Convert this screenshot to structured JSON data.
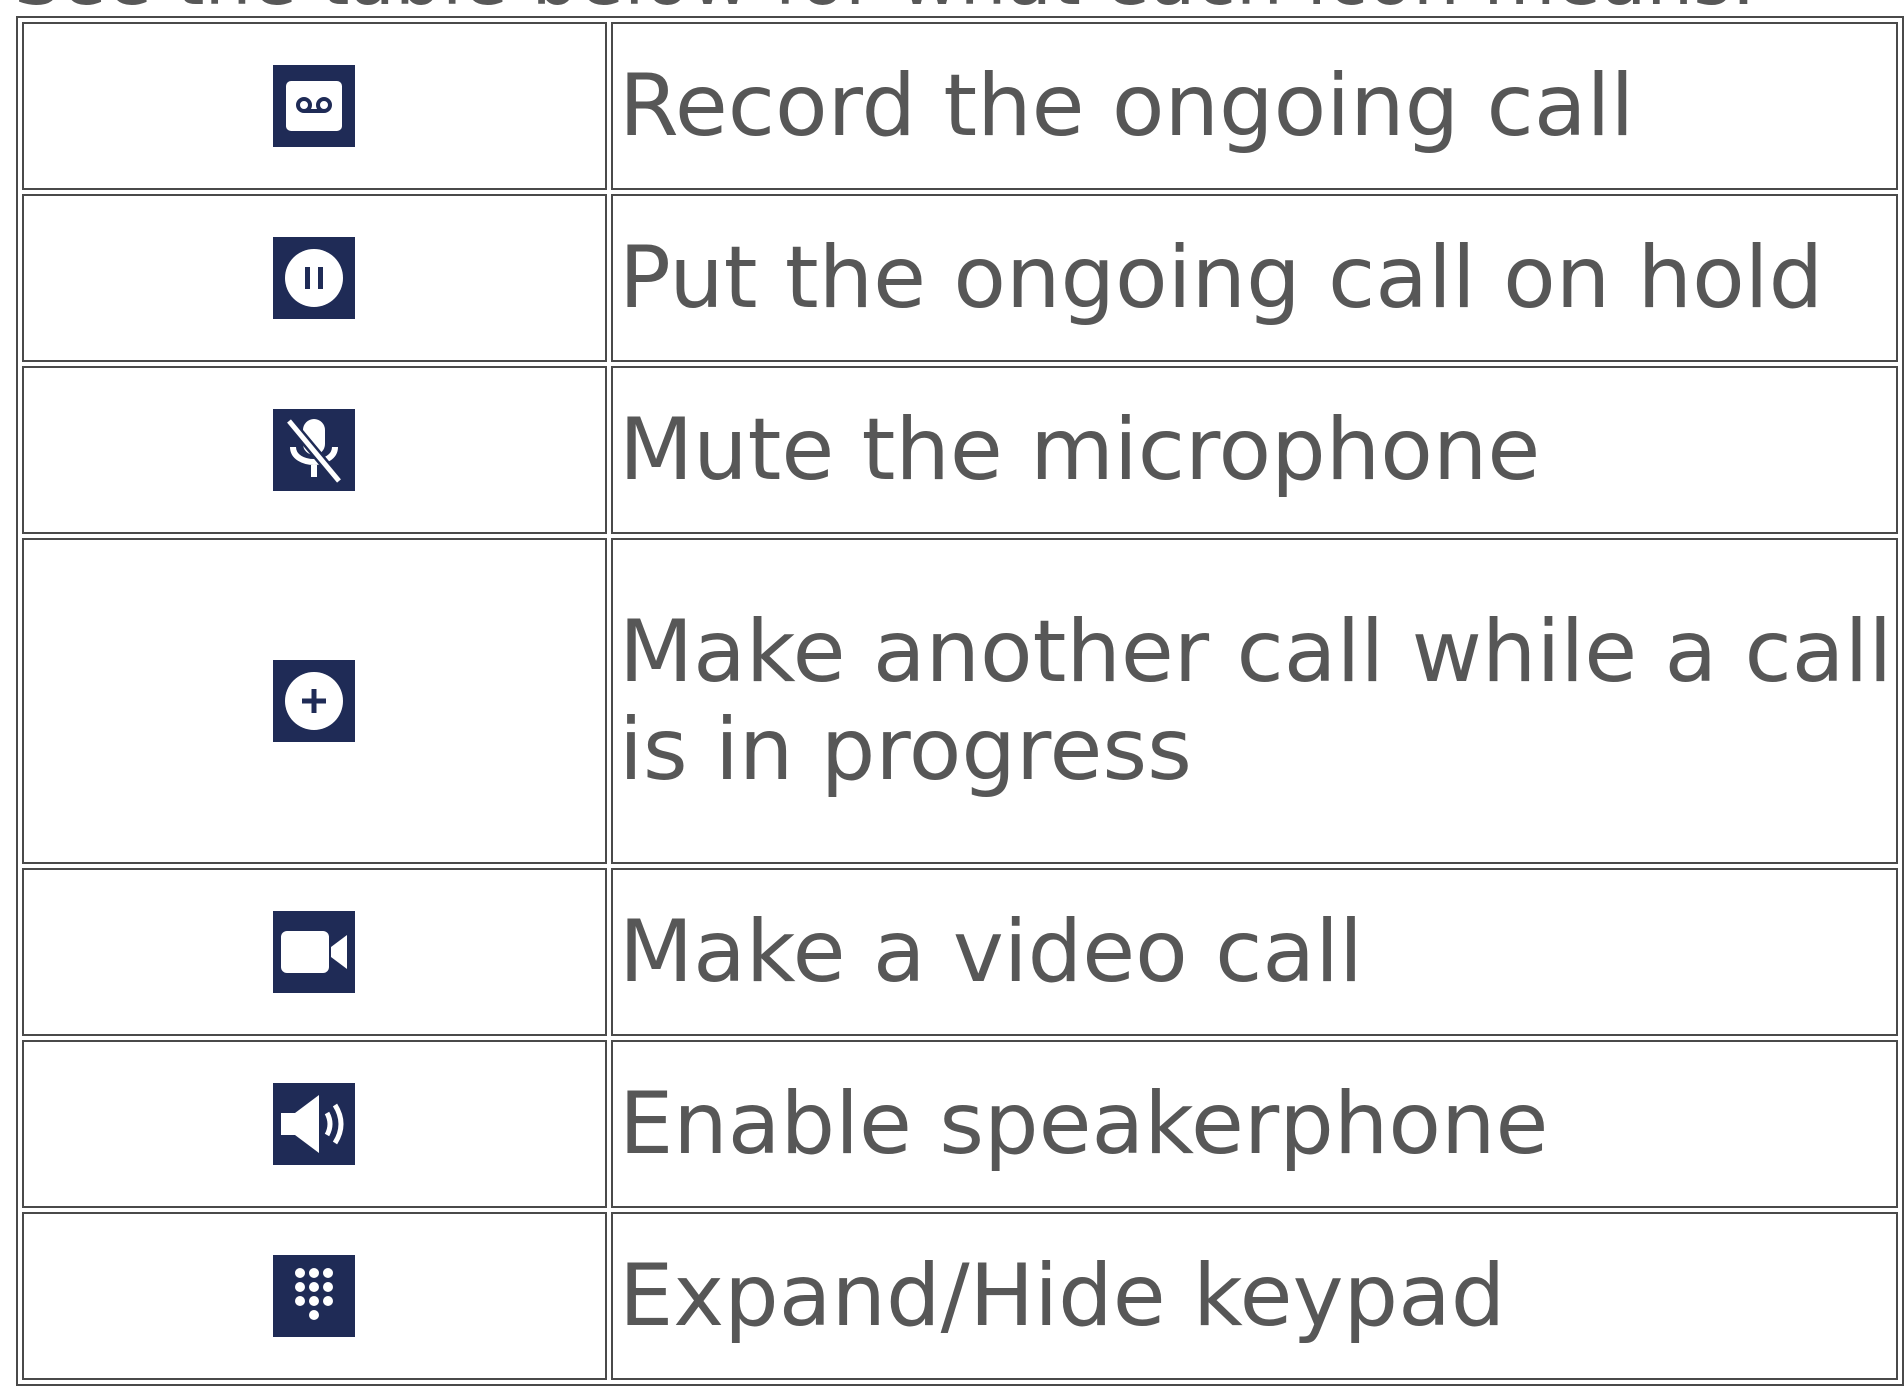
{
  "document": {
    "heading": "See the table below for what each icon means.",
    "icon_color": "#1f2b56",
    "text_color": "#575757",
    "rows": [
      {
        "icon": "record-icon",
        "description": "Record the ongoing call"
      },
      {
        "icon": "hold-icon",
        "description": "Put the ongoing call on hold"
      },
      {
        "icon": "mute-microphone-icon",
        "description": "Mute the microphone"
      },
      {
        "icon": "add-call-icon",
        "description": "Make another call while a call is in progress"
      },
      {
        "icon": "video-call-icon",
        "description": "Make a video call"
      },
      {
        "icon": "speakerphone-icon",
        "description": "Enable speakerphone"
      },
      {
        "icon": "keypad-icon",
        "description": "Expand/Hide keypad"
      }
    ]
  }
}
